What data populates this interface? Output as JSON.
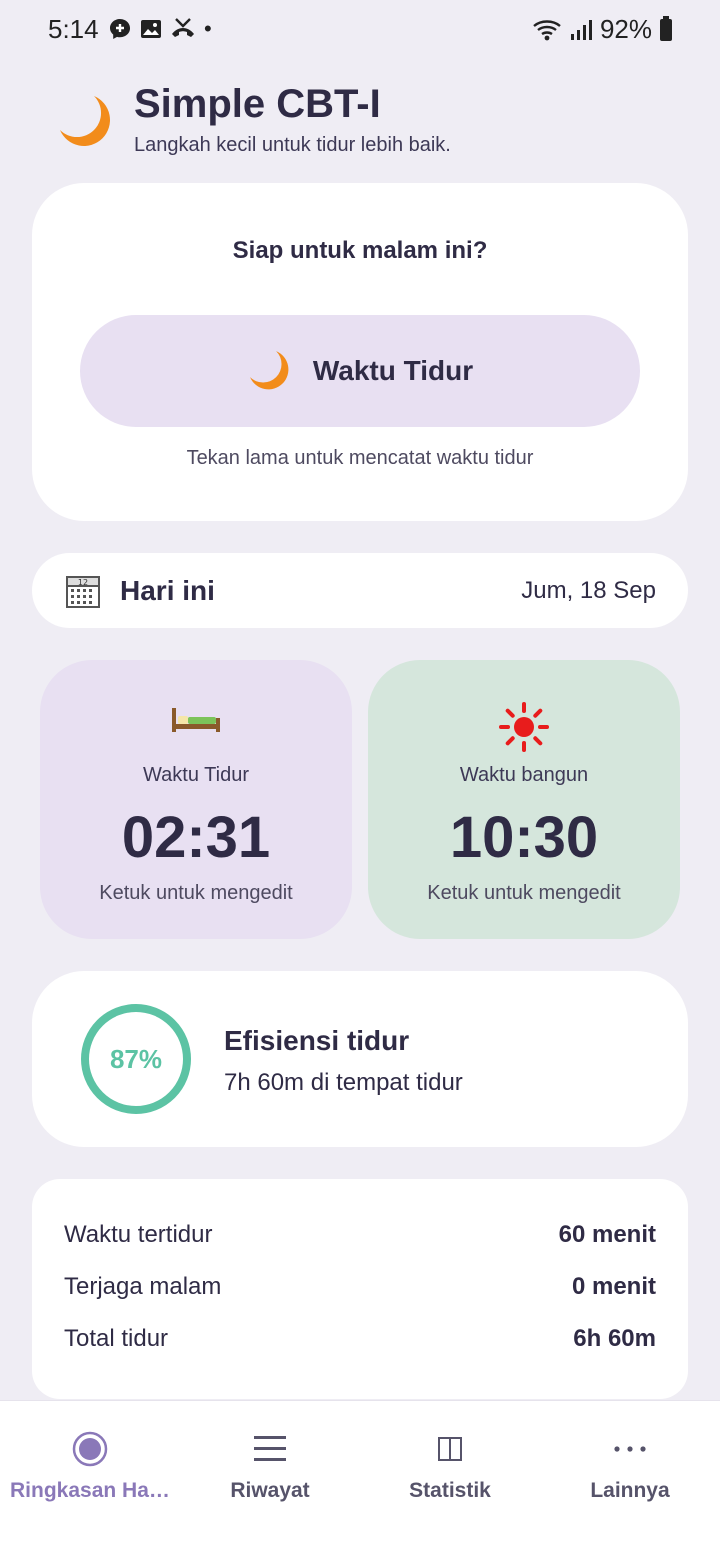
{
  "status_bar": {
    "time": "5:14",
    "battery": "92%",
    "icons": [
      "messenger-icon",
      "image-icon",
      "missed-call-icon",
      "dot-icon",
      "wifi-icon",
      "signal-icon",
      "battery-icon"
    ]
  },
  "header": {
    "title": "Simple CBT-I",
    "subtitle": "Langkah kecil untuk tidur lebih baik.",
    "logo_icon": "crescent-moon-icon"
  },
  "bedtime_card": {
    "prompt": "Siap untuk malam ini?",
    "button_label": "Waktu Tidur",
    "hint": "Tekan lama untuk mencatat waktu tidur"
  },
  "today": {
    "label": "Hari ini",
    "date": "Jum, 18 Sep"
  },
  "sleep_time": {
    "label": "Waktu Tidur",
    "value": "02:31",
    "hint": "Ketuk untuk mengedit",
    "icon": "bed-icon"
  },
  "wake_time": {
    "label": "Waktu bangun",
    "value": "10:30",
    "hint": "Ketuk untuk mengedit",
    "icon": "sun-icon"
  },
  "efficiency": {
    "percent_text": "87%",
    "percent": 87,
    "title": "Efisiensi tidur",
    "subtitle": "7h 60m di tempat tidur"
  },
  "stats": [
    {
      "label": "Waktu tertidur",
      "value": "60 menit"
    },
    {
      "label": "Terjaga malam",
      "value": "0 menit"
    },
    {
      "label": "Total tidur",
      "value": "6h 60m"
    }
  ],
  "nav": [
    {
      "label": "Ringkasan Harian",
      "icon": "radio-dot-icon",
      "active": true
    },
    {
      "label": "Riwayat",
      "icon": "list-icon",
      "active": false
    },
    {
      "label": "Statistik",
      "icon": "book-icon",
      "active": false
    },
    {
      "label": "Lainnya",
      "icon": "more-icon",
      "active": false
    }
  ],
  "colors": {
    "background": "#efedf4",
    "accent": "#8a78b8",
    "sleep_card": "#e8e0f2",
    "wake_card": "#d5e6dc",
    "efficiency_ring": "#5cc3a4",
    "moon": "#f28c1b"
  }
}
